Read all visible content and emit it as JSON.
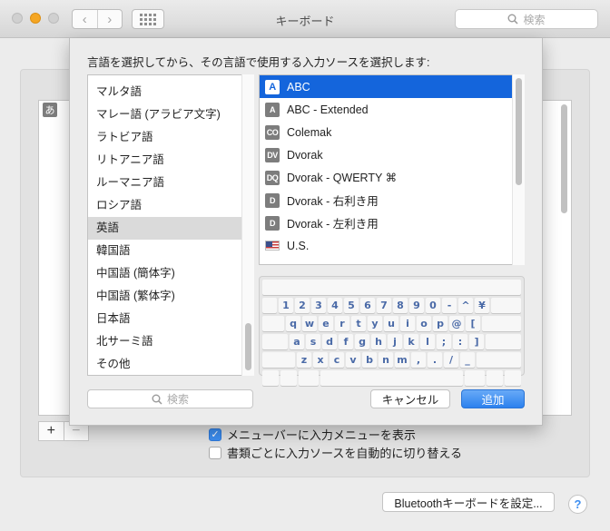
{
  "window": {
    "title": "キーボード",
    "search_placeholder": "検索",
    "back_icon": "‹",
    "forward_icon": "›"
  },
  "background": {
    "list_badge": "あ",
    "add_label": "+",
    "remove_label": "−",
    "checkbox_show_menu": {
      "label": "メニューバーに入力メニューを表示",
      "checked": true
    },
    "checkbox_auto_switch": {
      "label": "書類ごとに入力ソースを自動的に切り替える",
      "checked": false
    },
    "bluetooth_button": "Bluetoothキーボードを設定...",
    "help_label": "?"
  },
  "sheet": {
    "prompt": "言語を選択してから、その言語で使用する入力ソースを選択します:",
    "languages": [
      {
        "label": "マルタ語",
        "selected": false
      },
      {
        "label": "マレー語 (アラビア文字)",
        "selected": false
      },
      {
        "label": "ラトビア語",
        "selected": false
      },
      {
        "label": "リトアニア語",
        "selected": false
      },
      {
        "label": "ルーマニア語",
        "selected": false
      },
      {
        "label": "ロシア語",
        "selected": false
      },
      {
        "label": "英語",
        "selected": true
      },
      {
        "label": "韓国語",
        "selected": false
      },
      {
        "label": "中国語 (簡体字)",
        "selected": false
      },
      {
        "label": "中国語 (繁体字)",
        "selected": false
      },
      {
        "label": "日本語",
        "selected": false
      },
      {
        "label": "北サーミ語",
        "selected": false
      },
      {
        "label": "その他",
        "selected": false
      }
    ],
    "sources": [
      {
        "icon": "A",
        "label": "ABC",
        "selected": true
      },
      {
        "icon": "A",
        "label": "ABC - Extended",
        "selected": false
      },
      {
        "icon": "CO",
        "label": "Colemak",
        "selected": false
      },
      {
        "icon": "DV",
        "label": "Dvorak",
        "selected": false
      },
      {
        "icon": "DQ",
        "label": "Dvorak - QWERTY ⌘",
        "selected": false
      },
      {
        "icon": "D",
        "label": "Dvorak - 右利き用",
        "selected": false
      },
      {
        "icon": "D",
        "label": "Dvorak - 左利き用",
        "selected": false
      },
      {
        "icon": "flag",
        "label": "U.S.",
        "selected": false
      }
    ],
    "keyboard": {
      "row1": [
        "1",
        "2",
        "3",
        "4",
        "5",
        "6",
        "7",
        "8",
        "9",
        "0",
        "-",
        "^",
        "¥"
      ],
      "row2": [
        "q",
        "w",
        "e",
        "r",
        "t",
        "y",
        "u",
        "i",
        "o",
        "p",
        "@",
        "["
      ],
      "row3": [
        "a",
        "s",
        "d",
        "f",
        "g",
        "h",
        "j",
        "k",
        "l",
        ";",
        ":",
        "]"
      ],
      "row4": [
        "z",
        "x",
        "c",
        "v",
        "b",
        "n",
        "m",
        ",",
        ".",
        "/",
        "_"
      ]
    },
    "search_placeholder": "検索",
    "cancel_button": "キャンセル",
    "add_button": "追加"
  }
}
